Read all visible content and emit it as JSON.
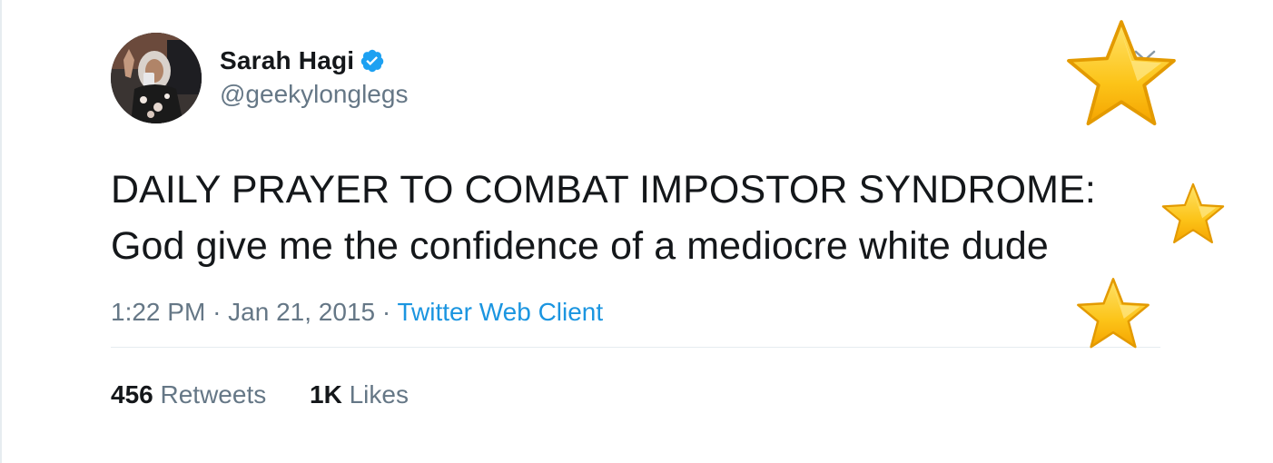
{
  "user": {
    "display_name": "Sarah Hagi",
    "handle": "@geekylonglegs",
    "verified": true
  },
  "tweet": {
    "lines": [
      "DAILY PRAYER TO COMBAT IMPOSTOR SYNDROME:",
      "God give me the confidence of a mediocre white dude"
    ],
    "time": "1:22 PM",
    "separator": "·",
    "date": "Jan 21, 2015",
    "source": "Twitter Web Client"
  },
  "stats": {
    "retweets_count": "456",
    "retweets_label": "Retweets",
    "likes_count": "1K",
    "likes_label": "Likes"
  },
  "colors": {
    "text": "#14171a",
    "secondary": "#657786",
    "link": "#1b95e0",
    "verified": "#1da1f2",
    "divider": "#e6ecf0",
    "star": "#f7c325"
  },
  "icons": {
    "verified": "verified-badge-icon",
    "caret": "chevron-down-icon",
    "stars": [
      "star-emoji-icon",
      "star-emoji-icon",
      "star-emoji-icon"
    ]
  }
}
